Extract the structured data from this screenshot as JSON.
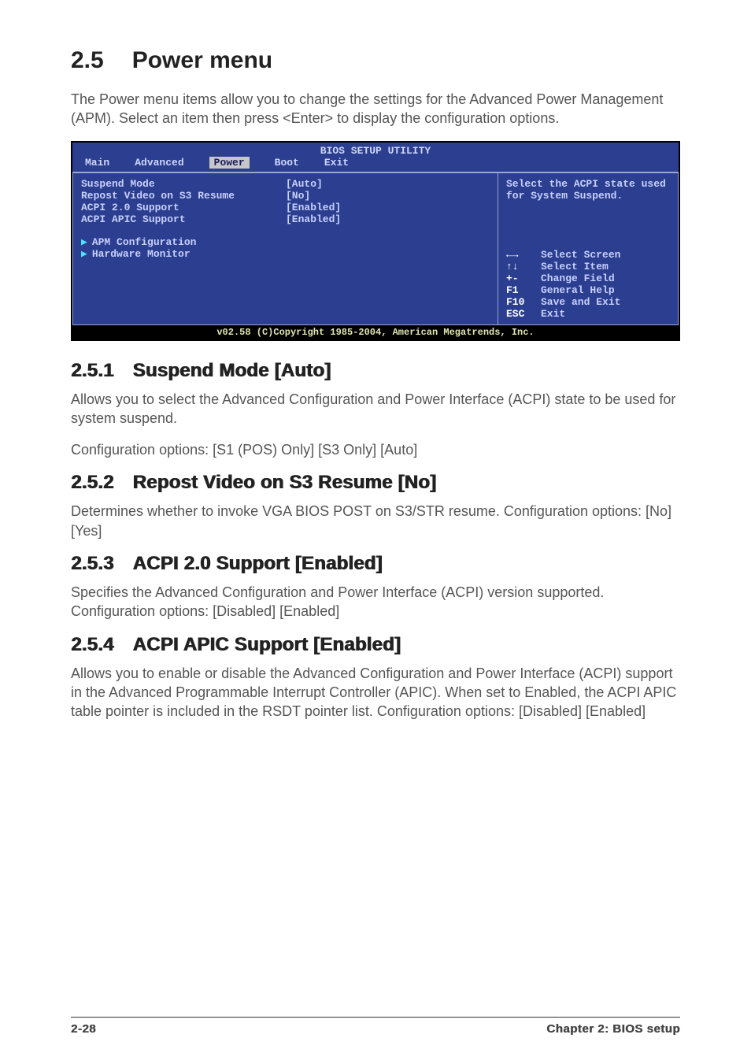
{
  "section": {
    "number": "2.5",
    "title": "Power menu",
    "intro": "The Power menu items allow you to change the settings for the Advanced Power Management (APM). Select an item then press <Enter> to display the configuration options."
  },
  "bios": {
    "title": "BIOS SETUP UTILITY",
    "tabs": [
      "Main",
      "Advanced",
      "Power",
      "Boot",
      "Exit"
    ],
    "active_tab": "Power",
    "items": [
      {
        "label": "Suspend Mode",
        "value": "[Auto]"
      },
      {
        "label": "Repost Video on S3 Resume",
        "value": "[No]"
      },
      {
        "label": "ACPI 2.0 Support",
        "value": "[Enabled]"
      },
      {
        "label": "ACPI APIC Support",
        "value": "[Enabled]"
      }
    ],
    "submenus": [
      "APM Configuration",
      "Hardware Monitor"
    ],
    "help": "Select the ACPI state used for System Suspend.",
    "keys": [
      {
        "key": "←→",
        "desc": "Select Screen"
      },
      {
        "key": "↑↓",
        "desc": "Select Item"
      },
      {
        "key": "+-",
        "desc": "Change Field"
      },
      {
        "key": "F1",
        "desc": "General Help"
      },
      {
        "key": "F10",
        "desc": "Save and Exit"
      },
      {
        "key": "ESC",
        "desc": "Exit"
      }
    ],
    "footer": "v02.58 (C)Copyright 1985-2004, American Megatrends, Inc."
  },
  "sub1": {
    "num": "2.5.1",
    "title": "Suspend Mode [Auto]",
    "p1": "Allows you to select the Advanced Configuration and Power Interface (ACPI) state to be used for system suspend.",
    "p2": "Configuration options: [S1 (POS) Only] [S3 Only] [Auto]"
  },
  "sub2": {
    "num": "2.5.2",
    "title": "Repost Video on S3 Resume [No]",
    "p1": "Determines whether to invoke VGA BIOS POST on S3/STR resume. Configuration options: [No] [Yes]"
  },
  "sub3": {
    "num": "2.5.3",
    "title": "ACPI 2.0 Support [Enabled]",
    "p1": "Specifies the Advanced Configuration and Power Interface (ACPI) version supported. Configuration options: [Disabled] [Enabled]"
  },
  "sub4": {
    "num": "2.5.4",
    "title": "ACPI APIC Support [Enabled]",
    "p1": "Allows you to enable or disable the Advanced Configuration and Power Interface (ACPI) support in the Advanced Programmable Interrupt Controller (APIC). When set to Enabled, the ACPI APIC table pointer is included in the RSDT pointer list. Configuration options: [Disabled] [Enabled]"
  },
  "footer": {
    "left": "2-28",
    "right": "Chapter 2: BIOS setup"
  }
}
